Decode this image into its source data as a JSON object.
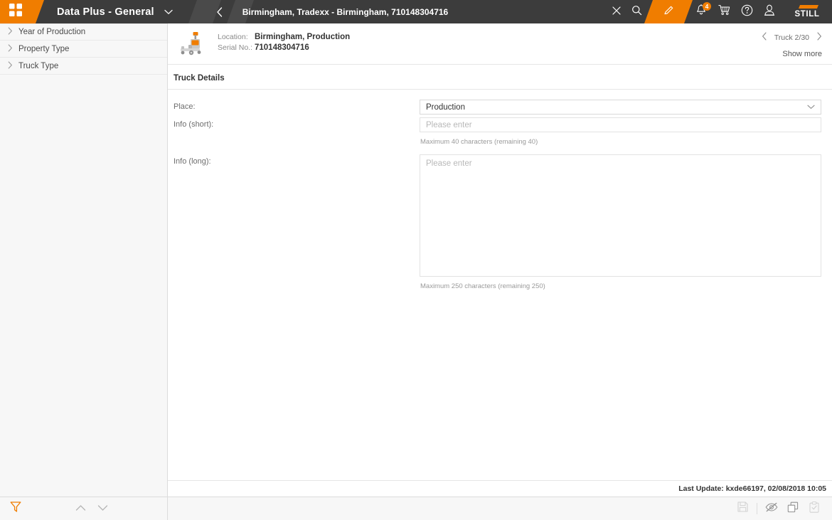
{
  "topbar": {
    "menu_icon": "grid-apps-icon",
    "app_title": "Data Plus - General",
    "app_title_chevron": "chevron-down-icon",
    "back_icon": "chevron-left-icon",
    "breadcrumb": "Birmingham, Tradexx - Birmingham, 710148304716",
    "actions": {
      "close": "close-icon",
      "search": "search-icon",
      "edit": "pencil-edit-icon",
      "notifications": "bell-icon",
      "notifications_badge": "4",
      "cart": "shopping-cart-icon",
      "help": "help-circle-icon",
      "user": "user-account-icon"
    },
    "brand": "STILL"
  },
  "sidebar": {
    "items": [
      {
        "label": "Year of Production",
        "icon": "chevron-right-icon"
      },
      {
        "label": "Property Type",
        "icon": "chevron-right-icon"
      },
      {
        "label": "Truck Type",
        "icon": "chevron-right-icon"
      }
    ],
    "footer": {
      "filter_icon": "filter-funnel-icon",
      "prev_icon": "chevron-up-icon",
      "next_icon": "chevron-down-icon"
    }
  },
  "truck_header": {
    "thumbnail": "pallet-truck-image",
    "location_label": "Location:",
    "location_value": "Birmingham, Production",
    "serial_label": "Serial No.:",
    "serial_value": "710148304716",
    "nav_prev_icon": "chevron-left-icon",
    "nav_counter": "Truck 2/30",
    "nav_next_icon": "chevron-right-icon",
    "show_more": "Show more"
  },
  "details": {
    "section_title": "Truck Details",
    "place": {
      "label": "Place:",
      "value": "Production",
      "chevron": "chevron-down-icon"
    },
    "info_short": {
      "label": "Info (short):",
      "placeholder": "Please enter",
      "value": "",
      "hint": "Maximum 40 characters (remaining 40)"
    },
    "info_long": {
      "label": "Info (long):",
      "placeholder": "Please enter",
      "value": "",
      "hint": "Maximum 250 characters (remaining 250)"
    }
  },
  "footer": {
    "last_update": "Last Update: kxde66197, 02/08/2018 10:05",
    "actions": [
      {
        "name": "save-icon",
        "disabled": true
      },
      {
        "name": "eye-slash-icon",
        "disabled": false
      },
      {
        "name": "copy-duplicate-icon",
        "disabled": false
      },
      {
        "name": "clipboard-check-icon",
        "disabled": true
      }
    ]
  },
  "colors": {
    "accent": "#f07d00",
    "topbar": "#3c3c3c",
    "topbar_light": "#4a4a4a",
    "panel": "#f7f7f7"
  }
}
